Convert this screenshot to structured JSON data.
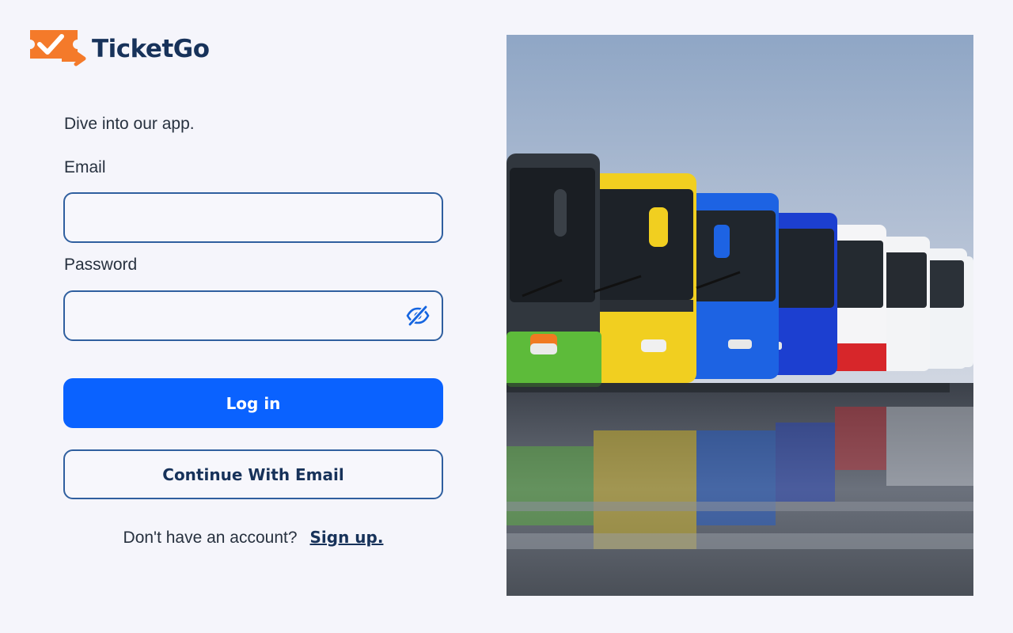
{
  "brand": {
    "name": "TicketGo",
    "accent_color": "#f47a2a",
    "primary_color": "#17325a"
  },
  "login": {
    "tagline": "Dive into our app.",
    "email_label": "Email",
    "email_value": "",
    "email_placeholder": "",
    "password_label": "Password",
    "password_value": "",
    "password_placeholder": "",
    "password_toggle_icon": "eye-off-icon",
    "login_button": "Log in",
    "continue_email_button": "Continue With Email",
    "signup_prompt": "Don't have an account?",
    "signup_link": "Sign up.",
    "button_color": "#0a62ff"
  },
  "hero_image": {
    "subject": "row of colorful buses reflected on wet pavement"
  }
}
